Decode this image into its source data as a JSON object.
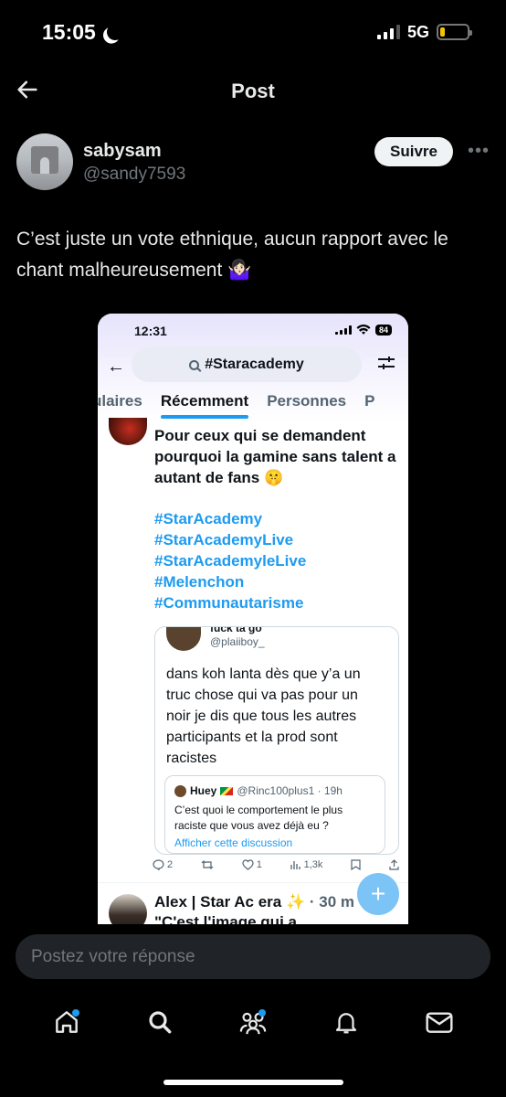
{
  "status_bar": {
    "time": "15:05",
    "network": "5G"
  },
  "header": {
    "title": "Post"
  },
  "author": {
    "name": "sabysam",
    "handle": "@sandy7593",
    "follow_label": "Suivre"
  },
  "post": {
    "text": "C’est juste un vote ethnique, aucun rapport avec le chant malheureusement 🤷🏻‍♀️"
  },
  "embedded_screenshot": {
    "time": "12:31",
    "battery": "84",
    "search_query": "#Staracademy",
    "tabs": [
      "ulaires",
      "Récemment",
      "Personnes",
      "P"
    ],
    "active_tab": "Récemment",
    "tweet": {
      "text": "Pour ceux qui se demandent pourquoi la gamine sans talent a autant de fans 🤫",
      "hashtags": [
        "#StarAcademy",
        "#StarAcademyLive",
        "#StarAcademyleLive",
        "#Melenchon",
        "#Communautarisme"
      ],
      "quote": {
        "name": "fuck ta go",
        "handle": "@plaiiboy_",
        "text": "dans koh lanta dès que y’a un truc chose qui va pas pour un noir je dis que tous les autres participants et la prod sont racistes",
        "nested_quote": {
          "name": "Huey",
          "meta": "@Rinc100plus1 · 19h",
          "text": "C’est quoi le comportement le plus raciste que vous avez déjà eu ?",
          "link": "Afficher cette discussion"
        }
      },
      "actions": {
        "replies": "2",
        "retweets": "",
        "likes": "1",
        "views": "1,3k"
      }
    },
    "next_tweet": {
      "name": "Alex | Star Ac era ✨",
      "time": "· 30 m",
      "text": "\"C'est l'image qui a"
    }
  },
  "reply": {
    "placeholder": "Postez votre réponse"
  },
  "nav": {
    "items": [
      "home-icon",
      "search-icon",
      "communities-icon",
      "notifications-icon",
      "messages-icon"
    ]
  },
  "colors": {
    "accent": "#1d9bf0",
    "background": "#000000"
  }
}
